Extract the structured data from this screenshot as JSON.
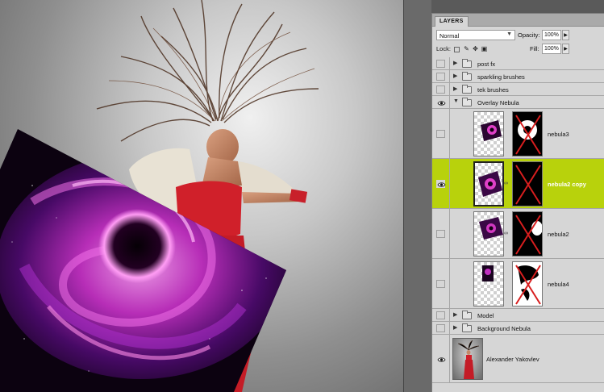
{
  "panel": {
    "tab_label": "LAYERS",
    "blend_mode": "Normal",
    "opacity_label": "Opacity:",
    "opacity_value": "100%",
    "lock_label": "Lock:",
    "fill_label": "Fill:",
    "fill_value": "100%"
  },
  "layers": {
    "post_fx": {
      "name": "post fx",
      "visible": false
    },
    "sparkling_brushes": {
      "name": "sparkling brushes",
      "visible": false
    },
    "tek_brushes": {
      "name": "tek brushes",
      "visible": false
    },
    "overlay_nebula": {
      "name": "Overlay Nebula",
      "visible": true,
      "expanded": true
    },
    "nebula3": {
      "name": "nebula3",
      "visible": false
    },
    "nebula2_copy": {
      "name": "nebula2 copy",
      "visible": true,
      "selected": true
    },
    "nebula2": {
      "name": "nebula2",
      "visible": false
    },
    "nebula4": {
      "name": "nebula4",
      "visible": false
    },
    "model": {
      "name": "Model",
      "visible": false
    },
    "background_nebula": {
      "name": "Background Nebula",
      "visible": false
    },
    "alexander": {
      "name": "Alexander Yakovlev",
      "visible": true
    }
  },
  "colors": {
    "selection": "#b8d20c",
    "mask_cross": "#d81e1e",
    "nebula_pink": "#e040c8"
  }
}
